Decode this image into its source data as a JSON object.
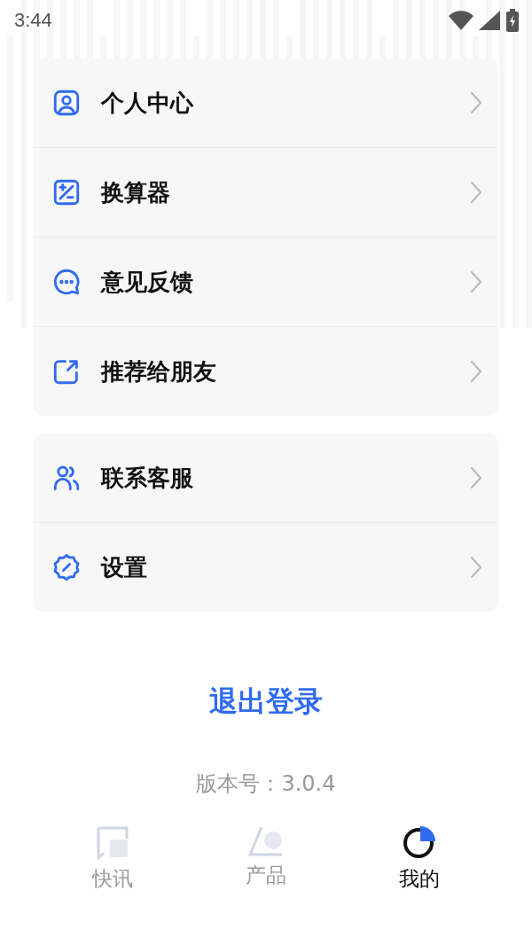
{
  "status_bar": {
    "time": "3:44"
  },
  "menu_groups": [
    {
      "items": [
        {
          "kind": "profile",
          "label": "个人中心"
        },
        {
          "kind": "calculator",
          "label": "换算器"
        },
        {
          "kind": "feedback",
          "label": "意见反馈"
        },
        {
          "kind": "share",
          "label": "推荐给朋友"
        }
      ]
    },
    {
      "items": [
        {
          "kind": "contact",
          "label": "联系客服"
        },
        {
          "kind": "settings",
          "label": "设置"
        }
      ]
    }
  ],
  "logout_button": "退出登录",
  "version": "版本号：3.0.4",
  "bottom_nav": [
    {
      "kind": "news",
      "label": "快讯",
      "selected": false
    },
    {
      "kind": "products",
      "label": "产品",
      "selected": false
    },
    {
      "kind": "mine",
      "label": "我的",
      "selected": true
    }
  ]
}
